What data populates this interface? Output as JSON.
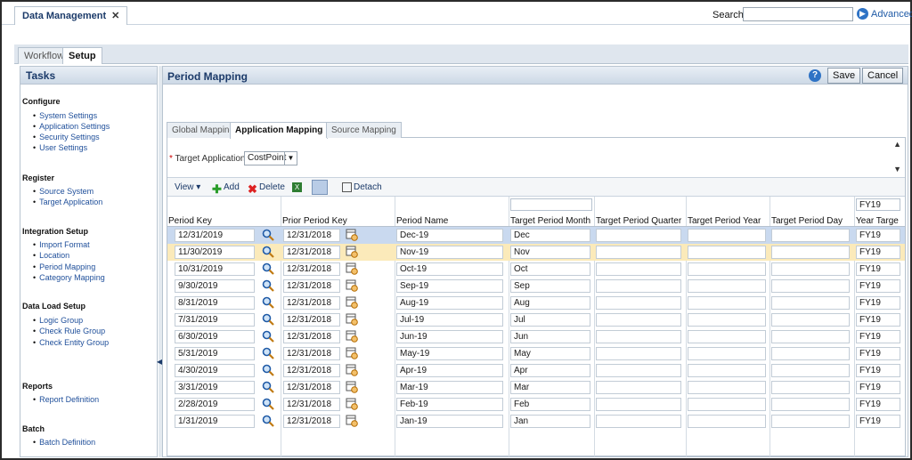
{
  "app": {
    "tab_title": "Data Management",
    "close_glyph": "✕"
  },
  "search": {
    "label": "Search:",
    "value": "",
    "advanced": "Advanced"
  },
  "workflow_tabs": [
    "Workflow",
    "Setup"
  ],
  "tasks": {
    "title": "Tasks",
    "sections": [
      {
        "name": "Configure",
        "items": [
          "System Settings",
          "Application Settings",
          "Security Settings",
          "User Settings"
        ]
      },
      {
        "name": "Register",
        "items": [
          "Source System",
          "Target Application"
        ]
      },
      {
        "name": "Integration Setup",
        "items": [
          "Import Format",
          "Location",
          "Period Mapping",
          "Category Mapping"
        ]
      },
      {
        "name": "Data Load Setup",
        "items": [
          "Logic Group",
          "Check Rule Group",
          "Check Entity Group"
        ]
      },
      {
        "name": "Reports",
        "items": [
          "Report Definition"
        ]
      },
      {
        "name": "Batch",
        "items": [
          "Batch Definition"
        ]
      }
    ]
  },
  "main": {
    "title": "Period Mapping",
    "help": "?",
    "save": "Save",
    "cancel": "Cancel",
    "tabs": [
      "Global Mapping",
      "Application Mapping",
      "Source Mapping"
    ],
    "target_app_label": "Target Application",
    "target_app_value": "CostPoint",
    "toolbar": {
      "view": "View",
      "add": "Add",
      "delete": "Delete",
      "detach": "Detach"
    },
    "filter_year": "FY19",
    "columns": [
      "Period Key",
      "Prior Period Key",
      "Period Name",
      "Target Period Month",
      "Target Period Quarter",
      "Target Period Year",
      "Target Period Day",
      "Year Targe"
    ],
    "rows": [
      {
        "period_key": "12/31/2019",
        "prior": "12/31/2018",
        "name": "Dec-19",
        "month": "Dec",
        "year_target": "FY19"
      },
      {
        "period_key": "11/30/2019",
        "prior": "12/31/2018",
        "name": "Nov-19",
        "month": "Nov",
        "year_target": "FY19"
      },
      {
        "period_key": "10/31/2019",
        "prior": "12/31/2018",
        "name": "Oct-19",
        "month": "Oct",
        "year_target": "FY19"
      },
      {
        "period_key": "9/30/2019",
        "prior": "12/31/2018",
        "name": "Sep-19",
        "month": "Sep",
        "year_target": "FY19"
      },
      {
        "period_key": "8/31/2019",
        "prior": "12/31/2018",
        "name": "Aug-19",
        "month": "Aug",
        "year_target": "FY19"
      },
      {
        "period_key": "7/31/2019",
        "prior": "12/31/2018",
        "name": "Jul-19",
        "month": "Jul",
        "year_target": "FY19"
      },
      {
        "period_key": "6/30/2019",
        "prior": "12/31/2018",
        "name": "Jun-19",
        "month": "Jun",
        "year_target": "FY19"
      },
      {
        "period_key": "5/31/2019",
        "prior": "12/31/2018",
        "name": "May-19",
        "month": "May",
        "year_target": "FY19"
      },
      {
        "period_key": "4/30/2019",
        "prior": "12/31/2018",
        "name": "Apr-19",
        "month": "Apr",
        "year_target": "FY19"
      },
      {
        "period_key": "3/31/2019",
        "prior": "12/31/2018",
        "name": "Mar-19",
        "month": "Mar",
        "year_target": "FY19"
      },
      {
        "period_key": "2/28/2019",
        "prior": "12/31/2018",
        "name": "Feb-19",
        "month": "Feb",
        "year_target": "FY19"
      },
      {
        "period_key": "1/31/2019",
        "prior": "12/31/2018",
        "name": "Jan-19",
        "month": "Jan",
        "year_target": "FY19"
      }
    ]
  },
  "colors": {
    "header_blue": "#1b3a69",
    "link_blue": "#1f4f9a",
    "selected_row": "#c9d9ef",
    "hover_row": "#fbeaba"
  }
}
